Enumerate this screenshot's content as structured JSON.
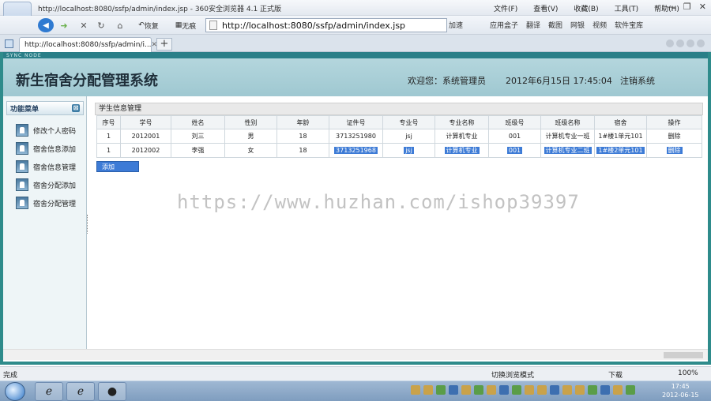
{
  "browser": {
    "title": "http://localhost:8080/ssfp/admin/index.jsp - 360安全浏览器 4.1 正式版",
    "menus": [
      "文件(F)",
      "查看(V)",
      "收藏(B)",
      "工具(T)",
      "帮助(H)"
    ],
    "undo_label": "恢复",
    "trace_label": "无痕",
    "address": "http://localhost:8080/ssfp/admin/index.jsp",
    "accel_label": "加速",
    "tools": [
      "应用盒子",
      "翻译",
      "截图",
      "网银",
      "视频",
      "软件宝库"
    ],
    "tab_title": "http://localhost:8080/ssfp/admin/i...",
    "status_text": "完成",
    "compat_mode": "切换浏览模式",
    "download_label": "下载",
    "zoom": "100%"
  },
  "app": {
    "strip_text": "SYNC NODE",
    "system_title": "新生宿舍分配管理系统",
    "welcome": "欢迎您：系统管理员",
    "datetime": "2012年6月15日  17:45:04",
    "logout": "注销系统"
  },
  "sidebar": {
    "header": "功能菜单",
    "items": [
      {
        "label": "修改个人密码"
      },
      {
        "label": "宿舍信息添加"
      },
      {
        "label": "宿舍信息管理"
      },
      {
        "label": "宿舍分配添加"
      },
      {
        "label": "宿舍分配管理"
      }
    ]
  },
  "grid": {
    "title": "学生信息管理",
    "columns": [
      "序号",
      "学号",
      "姓名",
      "性别",
      "年龄",
      "证件号",
      "专业号",
      "专业名称",
      "班级号",
      "班级名称",
      "宿舍",
      "操作"
    ],
    "rows": [
      [
        "1",
        "2012001",
        "刘三",
        "男",
        "18",
        "3713251980",
        "jsj",
        "计算机专业",
        "001",
        "计算机专业一班",
        "1#楼1单元101",
        "删除"
      ],
      [
        "1",
        "2012002",
        "李强",
        "女",
        "18",
        "3713251968",
        "jsj",
        "计算机专业",
        "001",
        "计算机专业二班",
        "1#楼2单元101",
        "删除"
      ]
    ],
    "add_button": "添加"
  },
  "watermark": "https://www.huzhan.com/ishop39397",
  "taskbar": {
    "time": "17:45",
    "date": "2012-06-15"
  }
}
